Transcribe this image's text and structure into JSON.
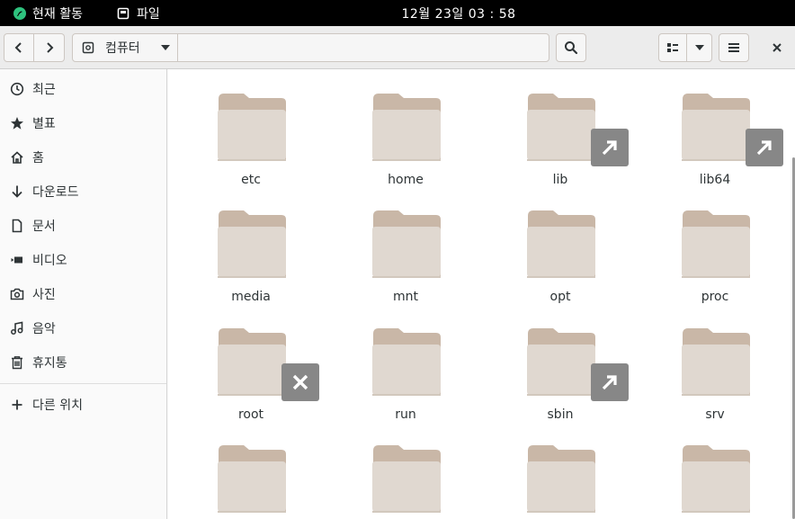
{
  "topbar": {
    "activities_label": "현재 활동",
    "app_menu_label": "파일",
    "clock": "12월 23일  03 : 58"
  },
  "headerbar": {
    "location_label": "컴퓨터",
    "location_text": ""
  },
  "sidebar": {
    "items": [
      {
        "label": "최근",
        "icon": "clock-icon"
      },
      {
        "label": "별표",
        "icon": "star-icon"
      },
      {
        "label": "홈",
        "icon": "home-icon"
      },
      {
        "label": "다운로드",
        "icon": "download-icon"
      },
      {
        "label": "문서",
        "icon": "document-icon"
      },
      {
        "label": "비디오",
        "icon": "video-icon"
      },
      {
        "label": "사진",
        "icon": "camera-icon"
      },
      {
        "label": "음악",
        "icon": "music-icon"
      },
      {
        "label": "휴지통",
        "icon": "trash-icon"
      }
    ],
    "other_locations": "다른 위치"
  },
  "files": [
    {
      "name": "etc",
      "emblem": null
    },
    {
      "name": "home",
      "emblem": null
    },
    {
      "name": "lib",
      "emblem": "symlink"
    },
    {
      "name": "lib64",
      "emblem": "symlink"
    },
    {
      "name": "media",
      "emblem": null
    },
    {
      "name": "mnt",
      "emblem": null
    },
    {
      "name": "opt",
      "emblem": null
    },
    {
      "name": "proc",
      "emblem": null
    },
    {
      "name": "root",
      "emblem": "unreadable"
    },
    {
      "name": "run",
      "emblem": null
    },
    {
      "name": "sbin",
      "emblem": "symlink"
    },
    {
      "name": "srv",
      "emblem": null
    },
    {
      "name": "",
      "emblem": null
    },
    {
      "name": "",
      "emblem": null
    },
    {
      "name": "",
      "emblem": null
    },
    {
      "name": "",
      "emblem": null
    }
  ],
  "colors": {
    "folder_back": "#c9b7a7",
    "folder_front": "#e0d8d0",
    "emblem": "#878787",
    "topbar": "#000000"
  }
}
